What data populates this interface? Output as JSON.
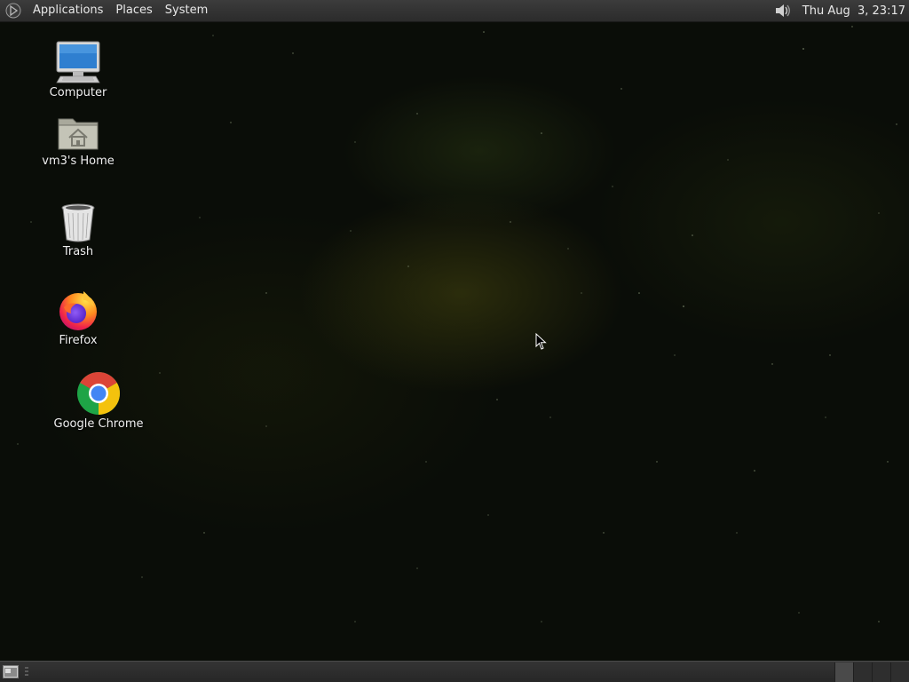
{
  "top_panel": {
    "menus": [
      "Applications",
      "Places",
      "System"
    ],
    "clock": "Thu Aug  3, 23:17",
    "volume_icon": "speaker-icon"
  },
  "desktop": {
    "icons": [
      {
        "label": "Computer",
        "icon": "computer-icon"
      },
      {
        "label": "vm3's Home",
        "icon": "home-folder-icon"
      },
      {
        "label": "Trash",
        "icon": "trash-icon"
      },
      {
        "label": "Firefox",
        "icon": "firefox-icon"
      },
      {
        "label": "Google Chrome",
        "icon": "chrome-icon"
      }
    ]
  },
  "bottom_panel": {
    "show_desktop_icon": "show-desktop-icon",
    "workspace_count": 4,
    "active_workspace": 1
  },
  "colors": {
    "panel": "#2f2f2f",
    "panel_text": "#e8e8e8",
    "desktop_bg": "#0a0d08"
  }
}
